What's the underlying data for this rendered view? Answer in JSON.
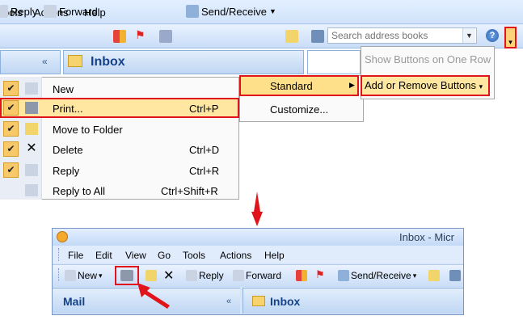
{
  "top": {
    "menu": [
      "ools",
      "Actions",
      "Help"
    ],
    "toolbar": {
      "reply": "Reply",
      "forward": "Forward",
      "send_receive": "Send/Receive",
      "search_placeholder": "Search address books",
      "help": "?",
      "overflow": "▾"
    },
    "left_chevron": "«",
    "inbox_title": "Inbox"
  },
  "context_menu": {
    "items": [
      {
        "label": "New",
        "shortcut": "",
        "checked": true
      },
      {
        "label": "Print...",
        "shortcut": "Ctrl+P",
        "checked": true
      },
      {
        "label": "Move to Folder",
        "shortcut": "",
        "checked": true
      },
      {
        "label": "Delete",
        "shortcut": "Ctrl+D",
        "checked": true
      },
      {
        "label": "Reply",
        "shortcut": "Ctrl+R",
        "checked": true
      },
      {
        "label": "Reply to All",
        "shortcut": "Ctrl+Shift+R",
        "checked": false
      }
    ],
    "check_glyph": "✔"
  },
  "submenu": {
    "standard": "Standard",
    "customize": "Customize...",
    "arrow": "▶"
  },
  "toolbar_options": {
    "show_one_row": "Show Buttons on One Row",
    "add_remove": "Add or Remove Buttons",
    "add_remove_arrow": "▾"
  },
  "outlook": {
    "title": "Inbox - Micr",
    "menu": [
      "File",
      "Edit",
      "View",
      "Go",
      "Tools",
      "Actions",
      "Help"
    ],
    "toolbar": {
      "new": "New",
      "new_arrow": "▾",
      "reply": "Reply",
      "forward": "Forward",
      "send_receive": "Send/Receive",
      "sr_arrow": "▾"
    },
    "mail_title": "Mail",
    "chevron": "«",
    "inbox_title": "Inbox"
  },
  "colors": {
    "highlight_red": "#e0141a",
    "accent_blue": "#15428b",
    "menu_hover": "#ffe7a2"
  }
}
